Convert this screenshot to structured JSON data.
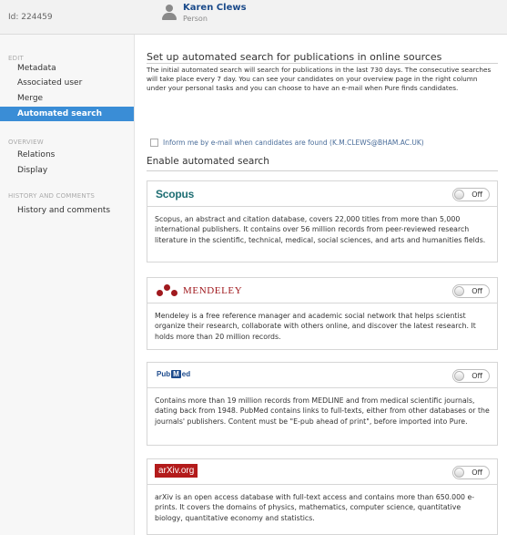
{
  "header": {
    "id_text": "Id: 224459",
    "person_name": "Karen Clews",
    "person_type": "Person",
    "person_icon": "person-icon"
  },
  "sidebar": {
    "edit_heading": "EDIT",
    "edit_items": [
      {
        "label": "Metadata",
        "active": false
      },
      {
        "label": "Associated user",
        "active": false
      },
      {
        "label": "Merge",
        "active": false
      },
      {
        "label": "Automated search",
        "active": true
      }
    ],
    "overview_heading": "OVERVIEW",
    "overview_items": [
      {
        "label": "Relations"
      },
      {
        "label": "Display"
      }
    ],
    "history_heading": "HISTORY AND COMMENTS",
    "history_items": [
      {
        "label": "History and comments"
      }
    ],
    "active_color": "#3a8dd6"
  },
  "main": {
    "title": "Set up automated search for publications in online sources",
    "intro": "The initial automated search will search for publications in the last 730 days. The consecutive searches will take place every 7 day. You can see your candidates on your overview page in the right column under your personal tasks and you can choose to have an e-mail when Pure finds candidates.",
    "inform_label": "Inform me by e-mail when candidates are found (K.M.CLEWS@BHAM.AC.UK)",
    "inform_checked": false,
    "enable_title": "Enable automated search",
    "sources": [
      {
        "name": "Scopus",
        "toggle": "Off",
        "description": "Scopus, an abstract and citation database, covers 22,000 titles from more than 5,000 international publishers. It contains over 56 million records from peer-reviewed research literature in the scientific, technical, medical, social sciences, and arts and humanities fields."
      },
      {
        "name": "MENDELEY",
        "toggle": "Off",
        "description": "Mendeley is a free reference manager and academic social network that helps scientist organize their research, collaborate with others online, and discover the latest research. It holds more than 20 million records."
      },
      {
        "name_pre": "Pub",
        "name_mid": "M",
        "name_post": "ed",
        "toggle": "Off",
        "description": "Contains more than 19 million records from MEDLINE and from medical scientific journals, dating back from 1948. PubMed contains links to full-texts, either from other databases or the journals' publishers. Content must be \"E-pub ahead of print\", before imported into Pure."
      },
      {
        "name": "arXiv.org",
        "toggle": "Off",
        "description": "arXiv is an open access database with full-text access and contains more than 650.000 e-prints. It covers the domains of physics, mathematics, computer science, quantitative biology, quantitative economy and statistics."
      }
    ]
  },
  "colors": {
    "scopus": "#1e6e73",
    "mendeley": "#a0191e",
    "pubmed": "#1c4a8c",
    "arxiv": "#b31b1b",
    "link": "#1a4a8a"
  }
}
